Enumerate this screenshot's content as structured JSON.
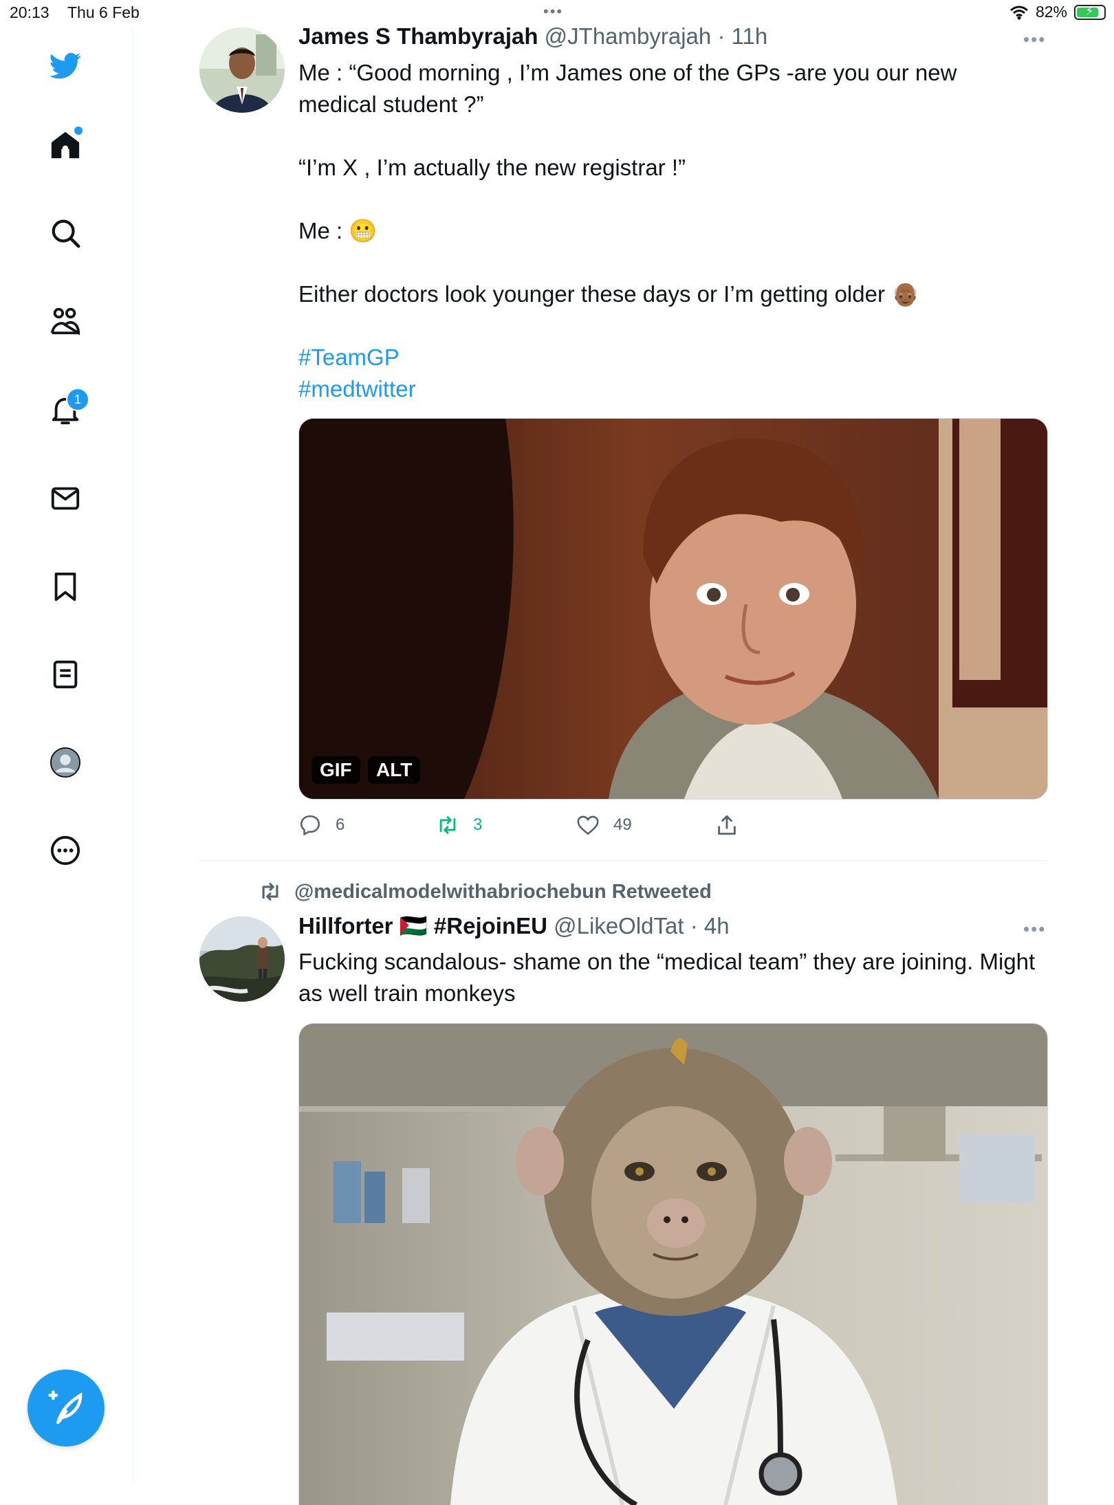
{
  "status_bar": {
    "time": "20:13",
    "date": "Thu 6 Feb",
    "battery": "82%",
    "battery_level": 0.82,
    "dots": "•••"
  },
  "sidebar": {
    "items": [
      {
        "name": "twitter-logo",
        "icon": "bird-icon"
      },
      {
        "name": "home",
        "icon": "home-icon",
        "has_dot": true
      },
      {
        "name": "explore",
        "icon": "search-icon"
      },
      {
        "name": "communities",
        "icon": "people-icon"
      },
      {
        "name": "notifications",
        "icon": "bell-icon",
        "badge": "1"
      },
      {
        "name": "messages",
        "icon": "envelope-icon"
      },
      {
        "name": "bookmarks",
        "icon": "bookmark-icon"
      },
      {
        "name": "lists",
        "icon": "list-icon"
      },
      {
        "name": "profile",
        "icon": "profile-icon"
      },
      {
        "name": "more",
        "icon": "more-circle-icon"
      }
    ],
    "compose_icon": "compose-feather-icon"
  },
  "tweets": [
    {
      "display_name": "James S Thambyrajah",
      "handle": "@JThambyrajah",
      "time": "· 11h",
      "more": "•••",
      "lines": [
        "Me : “Good morning , I’m James one of the GPs -are you our new medical student ?”",
        "“I’m X , I’m actually the new registrar !”",
        "Me : 😬",
        "Either doctors look younger these days  or I’m getting older 👴🏾"
      ],
      "hashtags": [
        "#TeamGP",
        "#medtwitter"
      ],
      "media_tags": {
        "gif": "GIF",
        "alt": "ALT"
      },
      "stats": {
        "replies": "6",
        "retweets": "3",
        "likes": "49"
      }
    },
    {
      "retweeted_by": "@medicalmodelwithabriochebun Retweeted",
      "display_name": "Hillforter 🇵🇸 #RejoinEU",
      "handle": "@LikeOldTat",
      "time": "· 4h",
      "more": "•••",
      "text": "Fucking scandalous- shame on the “medical team” they are joining. Might as well train monkeys"
    }
  ]
}
